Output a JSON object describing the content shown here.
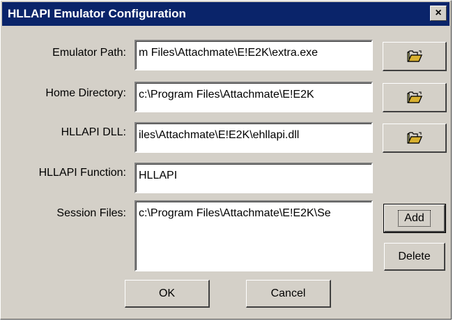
{
  "window": {
    "title": "HLLAPI Emulator Configuration",
    "close_glyph": "×"
  },
  "fields": {
    "emulator_path": {
      "label": "Emulator Path:",
      "value": "m Files\\Attachmate\\E!E2K\\extra.exe"
    },
    "home_directory": {
      "label": "Home Directory:",
      "value": "c:\\Program Files\\Attachmate\\E!E2K"
    },
    "hllapi_dll": {
      "label": "HLLAPI DLL:",
      "value": "iles\\Attachmate\\E!E2K\\ehllapi.dll"
    },
    "hllapi_function": {
      "label": "HLLAPI Function:",
      "value": "HLLAPI"
    },
    "session_files": {
      "label": "Session Files:",
      "value": "c:\\Program Files\\Attachmate\\E!E2K\\Se"
    }
  },
  "buttons": {
    "add": "Add",
    "delete": "Delete",
    "ok": "OK",
    "cancel": "Cancel"
  },
  "icons": {
    "browse": "open-folder-icon"
  },
  "colors": {
    "titlebar": "#0a246a",
    "face": "#d4d0c8"
  }
}
